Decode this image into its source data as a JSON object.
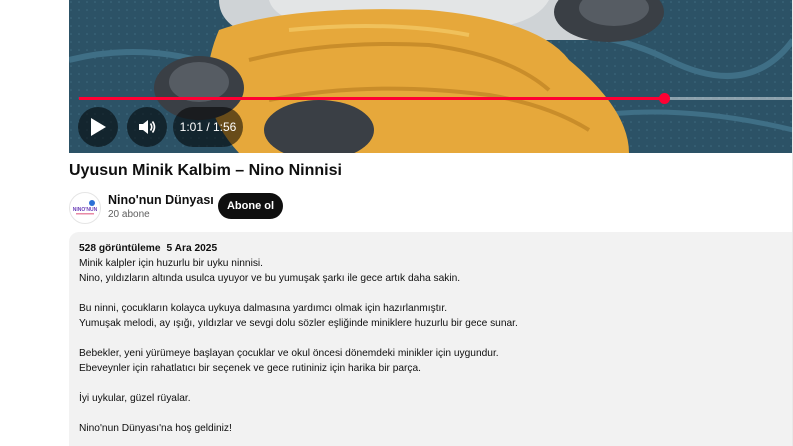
{
  "player": {
    "time_display": "1:01 / 1:56",
    "progress_fraction": 0.82,
    "accent_color": "#ff0033"
  },
  "video": {
    "title": "Uyusun Minik Kalbim – Nino Ninnisi"
  },
  "channel": {
    "name": "Nino'nun Dünyası",
    "subscribers": "20 abone",
    "avatar_text": "NINO NUN",
    "subscribe_label": "Abone ol"
  },
  "description": {
    "views": "528 görüntüleme",
    "date": "5 Ara 2025",
    "lines": [
      "Minik kalpler için huzurlu bir uyku ninnisi.",
      "Nino, yıldızların altında usulca uyuyor ve bu yumuşak şarkı ile gece artık daha sakin.",
      "",
      "Bu ninni, çocukların kolayca uykuya dalmasına yardımcı olmak için hazırlanmıştır.",
      "Yumuşak melodi, ay ışığı, yıldızlar ve sevgi dolu sözler eşliğinde miniklere huzurlu bir gece sunar.",
      "",
      "Bebekler, yeni yürümeye başlayan çocuklar ve okul öncesi dönemdeki minikler için uygundur.",
      "Ebeveynler için rahatlatıcı bir seçenek ve gece rutininiz için harika bir parça.",
      "",
      "İyi uykular, güzel rüyalar.",
      "",
      "Nino'nun Dünyası'na hoş geldiniz!"
    ]
  }
}
